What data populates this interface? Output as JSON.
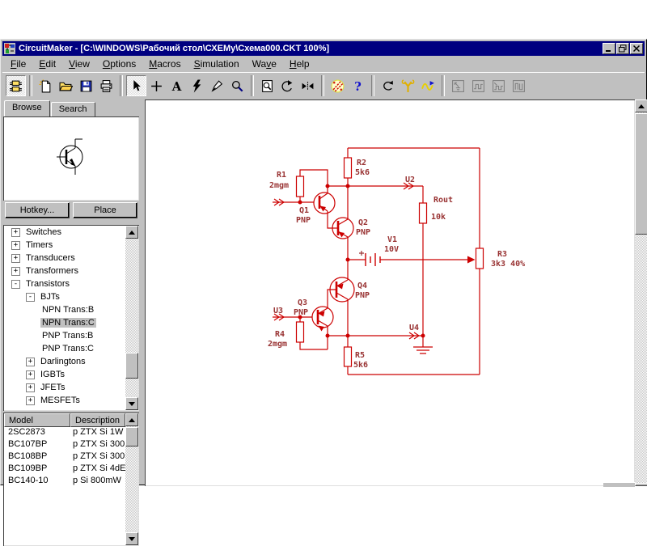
{
  "window": {
    "title": "CircuitMaker - [C:\\WINDOWS\\Рабочий стол\\СХЕМу\\Схема000.CKT 100%]"
  },
  "menu": {
    "items": [
      {
        "label": "File",
        "u": 0
      },
      {
        "label": "Edit",
        "u": 0
      },
      {
        "label": "View",
        "u": 0
      },
      {
        "label": "Options",
        "u": 0
      },
      {
        "label": "Macros",
        "u": 0
      },
      {
        "label": "Simulation",
        "u": 0
      },
      {
        "label": "Wave",
        "u": 2
      },
      {
        "label": "Help",
        "u": 0
      }
    ]
  },
  "toolbar": {
    "icons": [
      "browse-parts",
      "new-file",
      "open-file",
      "save-file",
      "print",
      "select-arrow",
      "draw-wire",
      "place-text",
      "delete-bolt",
      "probe-tool",
      "zoom-tool",
      "print-preview",
      "rotate",
      "mirror",
      "check-wires",
      "help",
      "reset-simulation",
      "simulation-setup",
      "analyses-wave",
      "scope-disabled",
      "digital-wave-disabled",
      "mixed-wave-disabled",
      "logic-disabled"
    ]
  },
  "sidebar": {
    "tabs": [
      {
        "label": "Browse",
        "active": true
      },
      {
        "label": "Search",
        "active": false
      }
    ],
    "buttons": {
      "hotkey": "Hotkey...",
      "place": "Place"
    },
    "tree": [
      {
        "label": "Switches",
        "level": 0,
        "expand": "plus"
      },
      {
        "label": "Timers",
        "level": 0,
        "expand": "plus"
      },
      {
        "label": "Transducers",
        "level": 0,
        "expand": "plus"
      },
      {
        "label": "Transformers",
        "level": 0,
        "expand": "plus"
      },
      {
        "label": "Transistors",
        "level": 0,
        "expand": "minus"
      },
      {
        "label": "BJTs",
        "level": 1,
        "expand": "minus"
      },
      {
        "label": "NPN Trans:B",
        "level": 2
      },
      {
        "label": "NPN Trans:C",
        "level": 2,
        "selected": true
      },
      {
        "label": "PNP Trans:B",
        "level": 2
      },
      {
        "label": "PNP Trans:C",
        "level": 2
      },
      {
        "label": "Darlingtons",
        "level": 1,
        "expand": "plus"
      },
      {
        "label": "IGBTs",
        "level": 1,
        "expand": "plus"
      },
      {
        "label": "JFETs",
        "level": 1,
        "expand": "plus"
      },
      {
        "label": "MESFETs",
        "level": 1,
        "expand": "plus"
      }
    ],
    "models": {
      "headers": [
        "Model",
        "Description"
      ],
      "rows": [
        {
          "model": "2SC2873",
          "desc": "p ZTX Si 1W"
        },
        {
          "model": "BC107BP",
          "desc": "p ZTX Si 300"
        },
        {
          "model": "BC108BP",
          "desc": "p ZTX Si 300"
        },
        {
          "model": "BC109BP",
          "desc": "p ZTX Si 4dE"
        },
        {
          "model": "BC140-10",
          "desc": "p Si 800mW"
        }
      ]
    }
  },
  "schematic": {
    "labels": {
      "r1": "R1",
      "r1_val": "2mgm",
      "r2": "R2",
      "r2_val": "5k6",
      "q1": "Q1",
      "q1_type": "PNP",
      "q2": "Q2",
      "q2_type": "PNP",
      "q3": "Q3",
      "q3_type": "PNP",
      "q4": "Q4",
      "q4_type": "PNP",
      "u2": "U2",
      "u3": "U3",
      "u4": "U4",
      "rout": "Rout",
      "rout_val": "10k",
      "v1": "V1",
      "v1_val": "10V",
      "r3": "R3",
      "r3_val": "3k3 40%",
      "r4": "R4",
      "r4_val": "2mgm",
      "r5": "R5",
      "r5_val": "5k6"
    }
  },
  "colors": {
    "titlebar": "#000080",
    "wire": "#cc0000",
    "label": "#993333",
    "chrome": "#c0c0c0"
  }
}
